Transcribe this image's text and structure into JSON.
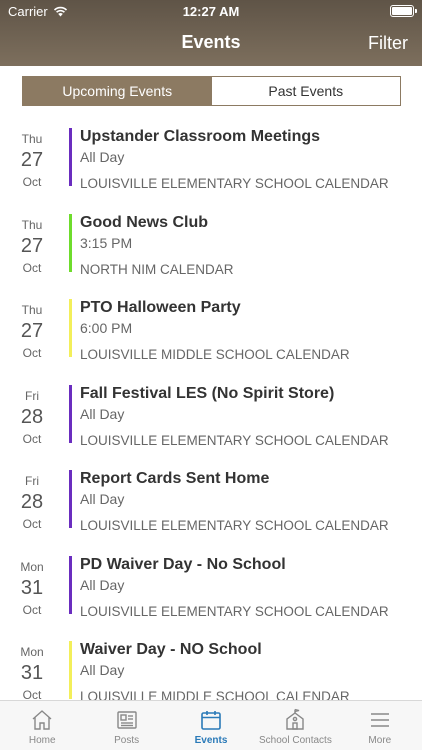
{
  "status": {
    "carrier": "Carrier",
    "time": "12:27 AM"
  },
  "header": {
    "title": "Events",
    "filter_label": "Filter"
  },
  "segments": {
    "upcoming": "Upcoming Events",
    "past": "Past Events"
  },
  "colors": {
    "header": "#6e6252",
    "segment_active": "#8c7a62",
    "tab_active": "#2a7ab8",
    "bar_purple": "#6a2dbf",
    "bar_green": "#6edc2c",
    "bar_yellow": "#f3ef5a"
  },
  "events": [
    {
      "dow": "Thu",
      "day": "27",
      "mon": "Oct",
      "title": "Upstander Classroom Meetings",
      "time": "All Day",
      "calendar": "LOUISVILLE ELEMENTARY SCHOOL CALENDAR",
      "bar_color": "#6a2dbf"
    },
    {
      "dow": "Thu",
      "day": "27",
      "mon": "Oct",
      "title": "Good News Club",
      "time": "3:15 PM",
      "calendar": "NORTH NIM CALENDAR",
      "bar_color": "#6edc2c"
    },
    {
      "dow": "Thu",
      "day": "27",
      "mon": "Oct",
      "title": "PTO Halloween Party",
      "time": "6:00 PM",
      "calendar": "LOUISVILLE MIDDLE SCHOOL CALENDAR",
      "bar_color": "#f3ef5a"
    },
    {
      "dow": "Fri",
      "day": "28",
      "mon": "Oct",
      "title": "Fall Festival LES (No Spirit Store)",
      "time": "All Day",
      "calendar": "LOUISVILLE ELEMENTARY SCHOOL CALENDAR",
      "bar_color": "#6a2dbf"
    },
    {
      "dow": "Fri",
      "day": "28",
      "mon": "Oct",
      "title": "Report Cards Sent Home",
      "time": "All Day",
      "calendar": "LOUISVILLE ELEMENTARY SCHOOL CALENDAR",
      "bar_color": "#6a2dbf"
    },
    {
      "dow": "Mon",
      "day": "31",
      "mon": "Oct",
      "title": "PD Waiver Day - No School",
      "time": "All Day",
      "calendar": "LOUISVILLE ELEMENTARY SCHOOL CALENDAR",
      "bar_color": "#6a2dbf"
    },
    {
      "dow": "Mon",
      "day": "31",
      "mon": "Oct",
      "title": "Waiver Day - NO School",
      "time": "All Day",
      "calendar": "LOUISVILLE MIDDLE SCHOOL CALENDAR",
      "bar_color": "#f3ef5a"
    }
  ],
  "tabs": [
    {
      "label": "Home",
      "icon": "home-icon"
    },
    {
      "label": "Posts",
      "icon": "newspaper-icon"
    },
    {
      "label": "Events",
      "icon": "calendar-icon",
      "active": true
    },
    {
      "label": "School Contacts",
      "icon": "school-icon"
    },
    {
      "label": "More",
      "icon": "menu-icon"
    }
  ]
}
